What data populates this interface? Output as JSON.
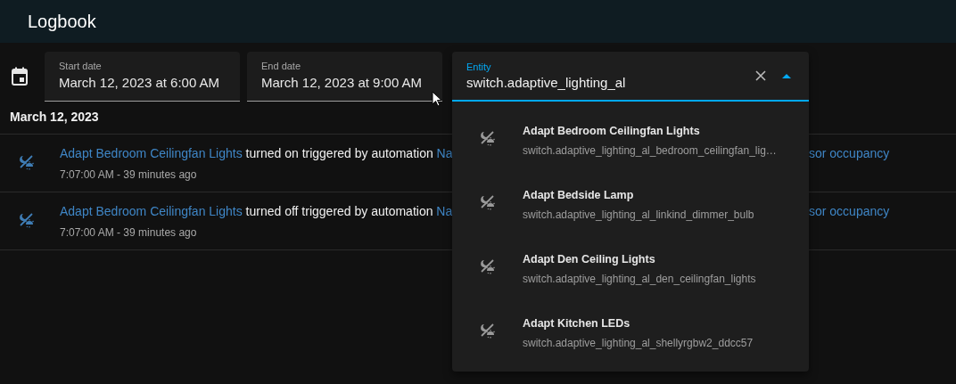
{
  "header": {
    "title": "Logbook"
  },
  "date_range": {
    "start": {
      "label": "Start date",
      "value": "March 12, 2023 at 6:00 AM"
    },
    "end": {
      "label": "End date",
      "value": "March 12, 2023 at 9:00 AM"
    }
  },
  "entity_picker": {
    "label": "Entity",
    "value": "switch.adaptive_lighting_al",
    "expanded": true,
    "options": [
      {
        "name": "Adapt Bedroom Ceilingfan Lights",
        "entity_id": "switch.adaptive_lighting_al_bedroom_ceilingfan_lig…"
      },
      {
        "name": "Adapt Bedside Lamp",
        "entity_id": "switch.adaptive_lighting_al_linkind_dimmer_bulb"
      },
      {
        "name": "Adapt Den Ceiling Lights",
        "entity_id": "switch.adaptive_lighting_al_den_ceilingfan_lights"
      },
      {
        "name": "Adapt Kitchen LEDs",
        "entity_id": "switch.adaptive_lighting_al_shellyrgbw2_ddcc57"
      }
    ]
  },
  "logbook": {
    "date_heading": "March 12, 2023",
    "entries": [
      {
        "entity": "Adapt Bedroom Ceilingfan Lights",
        "action": "turned on triggered by automation",
        "automation": "Na",
        "trailing": "sor occupancy",
        "time": "7:07:00 AM - 39 minutes ago"
      },
      {
        "entity": "Adapt Bedroom Ceilingfan Lights",
        "action": "turned off triggered by automation",
        "automation": "Na",
        "trailing": "sor occupancy",
        "time": "7:07:00 AM - 39 minutes ago"
      }
    ]
  }
}
